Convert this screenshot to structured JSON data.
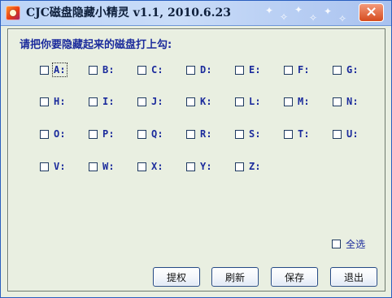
{
  "window": {
    "title": "CJC磁盘隐藏小精灵 v1.1, 2010.6.23",
    "close_glyph": "×"
  },
  "panel": {
    "prompt": "请把你要隐藏起来的磁盘打上勾:"
  },
  "drives": [
    {
      "label": "A:"
    },
    {
      "label": "B:"
    },
    {
      "label": "C:"
    },
    {
      "label": "D:"
    },
    {
      "label": "E:"
    },
    {
      "label": "F:"
    },
    {
      "label": "G:"
    },
    {
      "label": "H:"
    },
    {
      "label": "I:"
    },
    {
      "label": "J:"
    },
    {
      "label": "K:"
    },
    {
      "label": "L:"
    },
    {
      "label": "M:"
    },
    {
      "label": "N:"
    },
    {
      "label": "O:"
    },
    {
      "label": "P:"
    },
    {
      "label": "Q:"
    },
    {
      "label": "R:"
    },
    {
      "label": "S:"
    },
    {
      "label": "T:"
    },
    {
      "label": "U:"
    },
    {
      "label": "V:"
    },
    {
      "label": "W:"
    },
    {
      "label": "X:"
    },
    {
      "label": "Y:"
    },
    {
      "label": "Z:"
    }
  ],
  "select_all": {
    "label": "全选"
  },
  "buttons": {
    "extract": "提权",
    "refresh": "刷新",
    "save": "保存",
    "exit": "退出"
  },
  "colors": {
    "title_text": "#0e1f3b",
    "accent_blue": "#1b2b9c",
    "panel_bg": "#e9efe1"
  },
  "icons": {
    "app": "app-icon",
    "close": "close-icon"
  }
}
